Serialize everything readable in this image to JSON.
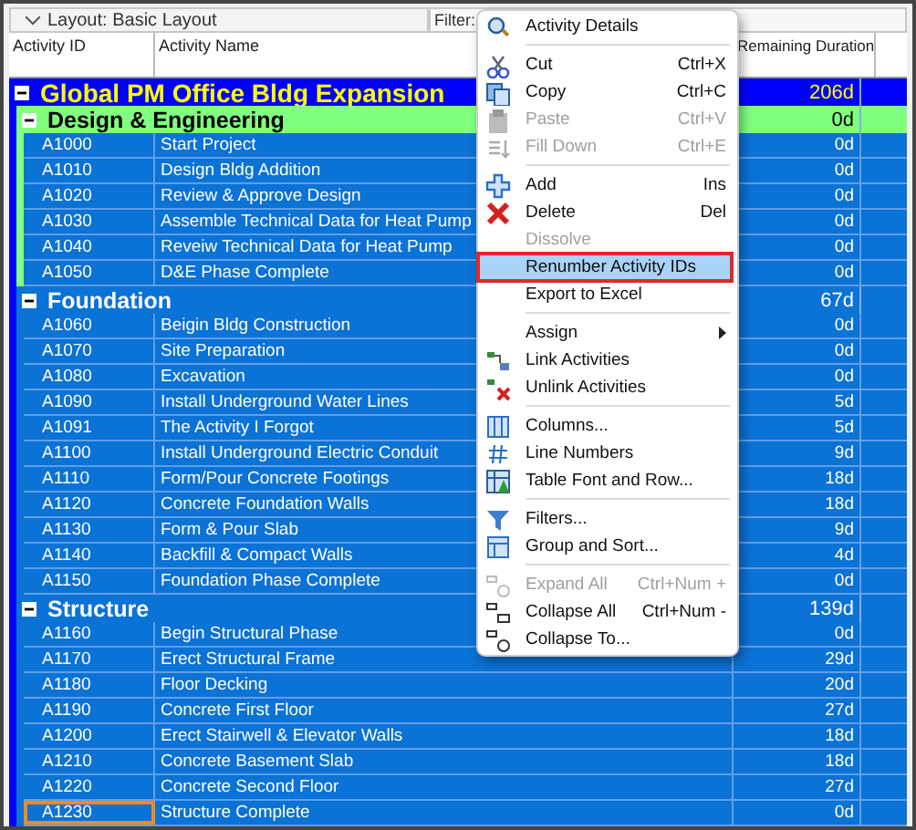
{
  "toolbar": {
    "layout": "Layout: Basic Layout",
    "filter": "Filter:"
  },
  "columns": [
    "Activity ID",
    "Activity Name",
    "Remaining Duration"
  ],
  "project": {
    "name": "Global PM Office Bldg Expansion",
    "duration": "206d",
    "expanded": true,
    "color": "#0000ff",
    "groups": [
      {
        "name": "Design & Engineering",
        "duration": "0d",
        "expanded": true,
        "color": "#80ff80",
        "activities": [
          {
            "id": "A1000",
            "name": "Start Project",
            "duration": "0d",
            "focused": false
          },
          {
            "id": "A1010",
            "name": "Design Bldg Addition",
            "duration": "0d",
            "focused": false
          },
          {
            "id": "A1020",
            "name": "Review & Approve Design",
            "duration": "0d",
            "focused": false
          },
          {
            "id": "A1030",
            "name": "Assemble Technical Data for Heat Pump",
            "duration": "0d",
            "focused": false
          },
          {
            "id": "A1040",
            "name": "Reveiw Technical Data for Heat Pump",
            "duration": "0d",
            "focused": false
          },
          {
            "id": "A1050",
            "name": "D&E Phase Complete",
            "duration": "0d",
            "focused": false
          }
        ]
      },
      {
        "name": "Foundation",
        "duration": "67d",
        "expanded": true,
        "color": "#0b72d6",
        "activities": [
          {
            "id": "A1060",
            "name": "Beigin Bldg Construction",
            "duration": "0d",
            "focused": false
          },
          {
            "id": "A1070",
            "name": "Site Preparation",
            "duration": "0d",
            "focused": false
          },
          {
            "id": "A1080",
            "name": "Excavation",
            "duration": "0d",
            "focused": false
          },
          {
            "id": "A1090",
            "name": "Install Underground Water Lines",
            "duration": "5d",
            "focused": false
          },
          {
            "id": "A1091",
            "name": "The Activity I Forgot",
            "duration": "5d",
            "focused": false
          },
          {
            "id": "A1100",
            "name": "Install Underground Electric Conduit",
            "duration": "9d",
            "focused": false
          },
          {
            "id": "A1110",
            "name": "Form/Pour Concrete Footings",
            "duration": "18d",
            "focused": false
          },
          {
            "id": "A1120",
            "name": "Concrete Foundation Walls",
            "duration": "18d",
            "focused": false
          },
          {
            "id": "A1130",
            "name": "Form & Pour Slab",
            "duration": "9d",
            "focused": false
          },
          {
            "id": "A1140",
            "name": "Backfill & Compact Walls",
            "duration": "4d",
            "focused": false
          },
          {
            "id": "A1150",
            "name": "Foundation Phase Complete",
            "duration": "0d",
            "focused": false
          }
        ]
      },
      {
        "name": "Structure",
        "duration": "139d",
        "expanded": true,
        "color": "#0b72d6",
        "activities": [
          {
            "id": "A1160",
            "name": "Begin Structural Phase",
            "duration": "0d",
            "focused": false
          },
          {
            "id": "A1170",
            "name": "Erect Structural Frame",
            "duration": "29d",
            "focused": false
          },
          {
            "id": "A1180",
            "name": "Floor Decking",
            "duration": "20d",
            "focused": false
          },
          {
            "id": "A1190",
            "name": "Concrete First Floor",
            "duration": "27d",
            "focused": false
          },
          {
            "id": "A1200",
            "name": "Erect Stairwell & Elevator Walls",
            "duration": "18d",
            "focused": false
          },
          {
            "id": "A1210",
            "name": "Concrete Basement Slab",
            "duration": "18d",
            "focused": false
          },
          {
            "id": "A1220",
            "name": "Concrete Second Floor",
            "duration": "27d",
            "focused": false
          },
          {
            "id": "A1230",
            "name": "Structure Complete",
            "duration": "0d",
            "focused": true
          }
        ]
      }
    ]
  },
  "context_menu": [
    {
      "kind": "item",
      "label": "Activity Details",
      "disabled": false,
      "selected": false
    },
    {
      "kind": "separator"
    },
    {
      "kind": "item",
      "label": "Cut",
      "shortcut": "Ctrl+X",
      "disabled": false,
      "selected": false
    },
    {
      "kind": "item",
      "label": "Copy",
      "shortcut": "Ctrl+C",
      "disabled": false,
      "selected": false
    },
    {
      "kind": "item",
      "label": "Paste",
      "shortcut": "Ctrl+V",
      "disabled": true,
      "selected": false
    },
    {
      "kind": "item",
      "label": "Fill Down",
      "shortcut": "Ctrl+E",
      "disabled": true,
      "selected": false
    },
    {
      "kind": "separator"
    },
    {
      "kind": "item",
      "label": "Add",
      "shortcut": "Ins",
      "disabled": false,
      "selected": false
    },
    {
      "kind": "item",
      "label": "Delete",
      "shortcut": "Del",
      "disabled": false,
      "selected": false
    },
    {
      "kind": "item",
      "label": "Dissolve",
      "disabled": true,
      "selected": false
    },
    {
      "kind": "item",
      "label": "Renumber Activity IDs",
      "disabled": false,
      "selected": true
    },
    {
      "kind": "item",
      "label": "Export to Excel",
      "disabled": false,
      "selected": false
    },
    {
      "kind": "separator"
    },
    {
      "kind": "submenu",
      "label": "Assign",
      "disabled": false,
      "selected": false
    },
    {
      "kind": "item",
      "label": "Link Activities",
      "disabled": false,
      "selected": false
    },
    {
      "kind": "item",
      "label": "Unlink Activities",
      "disabled": false,
      "selected": false
    },
    {
      "kind": "separator"
    },
    {
      "kind": "item",
      "label": "Columns...",
      "disabled": false,
      "selected": false
    },
    {
      "kind": "item",
      "label": "Line Numbers",
      "disabled": false,
      "selected": false
    },
    {
      "kind": "item",
      "label": "Table Font and Row...",
      "disabled": false,
      "selected": false
    },
    {
      "kind": "separator"
    },
    {
      "kind": "item",
      "label": "Filters...",
      "disabled": false,
      "selected": false
    },
    {
      "kind": "item",
      "label": "Group and Sort...",
      "disabled": false,
      "selected": false
    },
    {
      "kind": "separator"
    },
    {
      "kind": "item",
      "label": "Expand All",
      "shortcut": "Ctrl+Num +",
      "disabled": true,
      "selected": false
    },
    {
      "kind": "item",
      "label": "Collapse All",
      "shortcut": "Ctrl+Num -",
      "disabled": false,
      "selected": false
    },
    {
      "kind": "item",
      "label": "Collapse To...",
      "disabled": false,
      "selected": false
    }
  ]
}
